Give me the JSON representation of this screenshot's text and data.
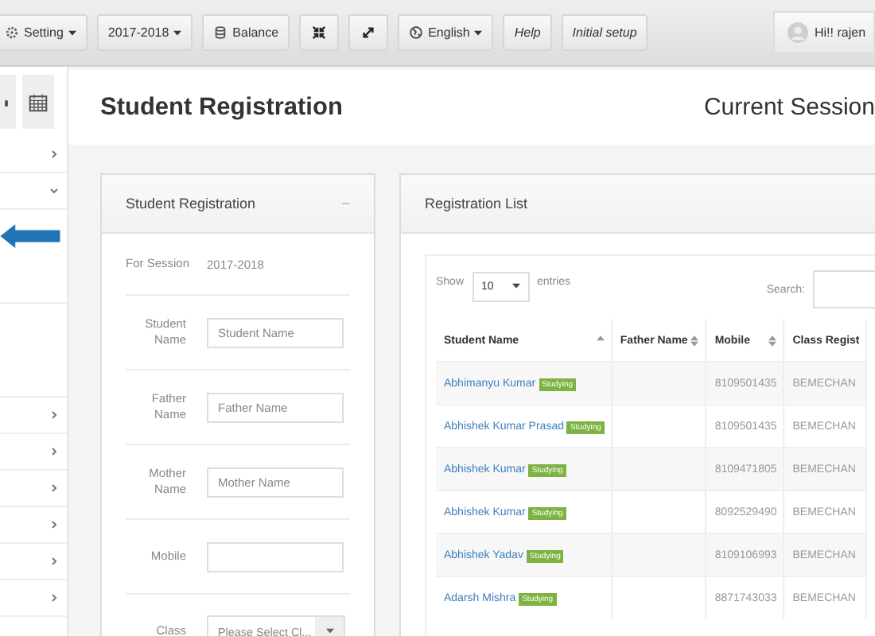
{
  "toolbar": {
    "buttons": [
      {
        "label": "Setting",
        "kind": "dropdown"
      },
      {
        "label": "2017-2018",
        "kind": "dropdown"
      },
      {
        "label": "Balance",
        "kind": "plain"
      },
      {
        "kind": "icon"
      },
      {
        "kind": "icon"
      },
      {
        "label": "English",
        "kind": "dropdown"
      },
      {
        "label": "Help",
        "kind": "italic"
      },
      {
        "label": "Initial setup",
        "kind": "italic"
      }
    ],
    "user": "Hi!! rajen"
  },
  "sidebar": {
    "items": [
      {
        "expanded": false
      },
      {
        "expanded": true
      },
      {
        "kind": "arrow"
      },
      {
        "kind": "blank"
      },
      {
        "expanded": false
      },
      {
        "expanded": false
      },
      {
        "expanded": false
      },
      {
        "expanded": false
      },
      {
        "expanded": false
      },
      {
        "expanded": false
      }
    ]
  },
  "page": {
    "title": "Student Registration",
    "session": "Current Session"
  },
  "form": {
    "title": "Student Registration",
    "collapse": "−",
    "fields": [
      {
        "kind": "static",
        "label": "For Session",
        "value": "2017-2018"
      },
      {
        "kind": "text",
        "label": "Student Name",
        "placeholder": "Student Name"
      },
      {
        "kind": "text",
        "label": "Father Name",
        "placeholder": "Father Name"
      },
      {
        "kind": "text",
        "label": "Mother Name",
        "placeholder": "Mother Name"
      },
      {
        "kind": "text",
        "label": "Mobile"
      },
      {
        "kind": "select",
        "label": "Class",
        "value": "Please Select Cl..."
      }
    ]
  },
  "list": {
    "title": "Registration List",
    "show": "Show",
    "entries": "entries",
    "page_size": "10",
    "search": "Search:",
    "columns": [
      {
        "label": "Student Name"
      },
      {
        "label": "Father Name"
      },
      {
        "label": "Mobile"
      },
      {
        "label": "Class Regist"
      }
    ],
    "rows": [
      {
        "name": "Abhimanyu Kumar",
        "status": "Studying",
        "mobile": "8109501435",
        "class": "BEMECHAN"
      },
      {
        "name": "Abhishek Kumar Prasad",
        "status": "Studying",
        "mobile": "8109501435",
        "class": "BEMECHAN"
      },
      {
        "name": "Abhishek Kumar",
        "status": "Studying",
        "mobile": "8109471805",
        "class": "BEMECHAN"
      },
      {
        "name": "Abhishek Kumar",
        "status": "Studying",
        "mobile": "8092529490",
        "class": "BEMECHAN"
      },
      {
        "name": "Abhishek Yadav",
        "status": "Studying",
        "mobile": "8109106993",
        "class": "BEMECHAN"
      },
      {
        "name": "Adarsh Mishra",
        "status": "Studying",
        "mobile": "8871743033",
        "class": "BEMECHAN"
      }
    ]
  }
}
